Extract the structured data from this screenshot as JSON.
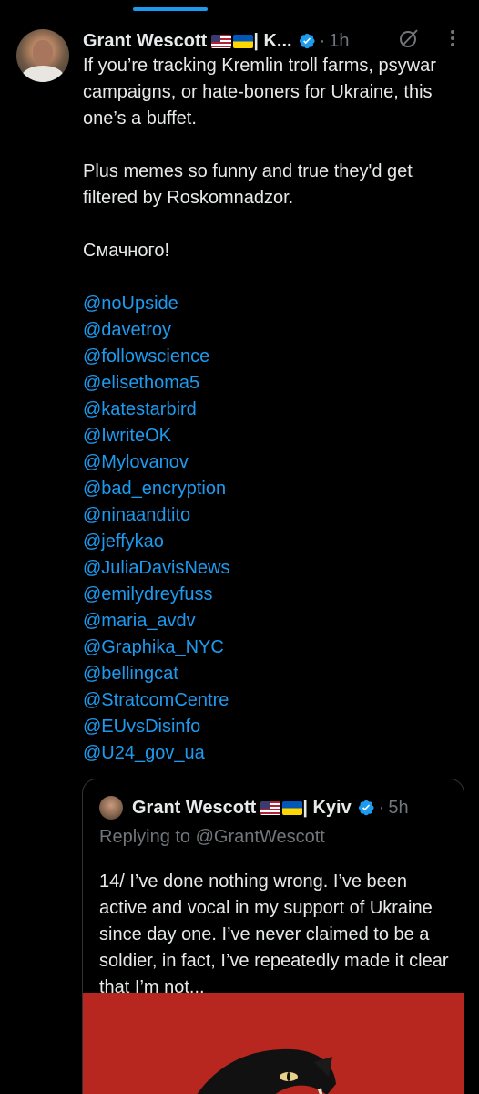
{
  "tweet": {
    "author_name": "Grant Wescott",
    "name_suffix": " | K...",
    "time_ago": "1h",
    "paragraphs": [
      "If you’re tracking Kremlin troll farms, psywar campaigns, or hate-boners for Ukraine, this one’s a buffet.",
      "Plus memes so funny and true they'd get filtered by Roskomnadzor.",
      "Смачного!"
    ],
    "mentions": [
      "@noUpside",
      "@davetroy",
      "@followscience",
      "@elisethoma5",
      "@katestarbird",
      "@IwriteOK",
      "@Mylovanov",
      "@bad_encryption",
      "@ninaandtito",
      "@jeffykao",
      "@JuliaDavisNews",
      "@emilydreyfuss",
      "@maria_avdv",
      "@Graphika_NYC",
      "@bellingcat",
      "@StratcomCentre",
      "@EUvsDisinfo",
      "@U24_gov_ua"
    ]
  },
  "quote": {
    "author_name": "Grant Wescott",
    "name_suffix": " | Kyiv",
    "time_ago": "5h",
    "replying_to_label": "Replying to",
    "replying_to_handle": "@GrantWescott",
    "text": "14/ I’ve done nothing wrong. I’ve been active and vocal in my support of Ukraine since day one. I’ve never claimed to be a soldier, in fact, I’ve repeatedly made it clear that I’m not..."
  },
  "icons": {
    "verified": "verified-badge-icon",
    "grok": "grok-icon",
    "more": "more-icon",
    "flags": [
      "us-flag-icon",
      "ukraine-flag-icon"
    ]
  },
  "colors": {
    "background": "#000000",
    "text": "#e7e9ea",
    "muted": "#71767b",
    "link": "#1d9bf0",
    "border": "#2f3336",
    "media_red": "#b8271f"
  }
}
